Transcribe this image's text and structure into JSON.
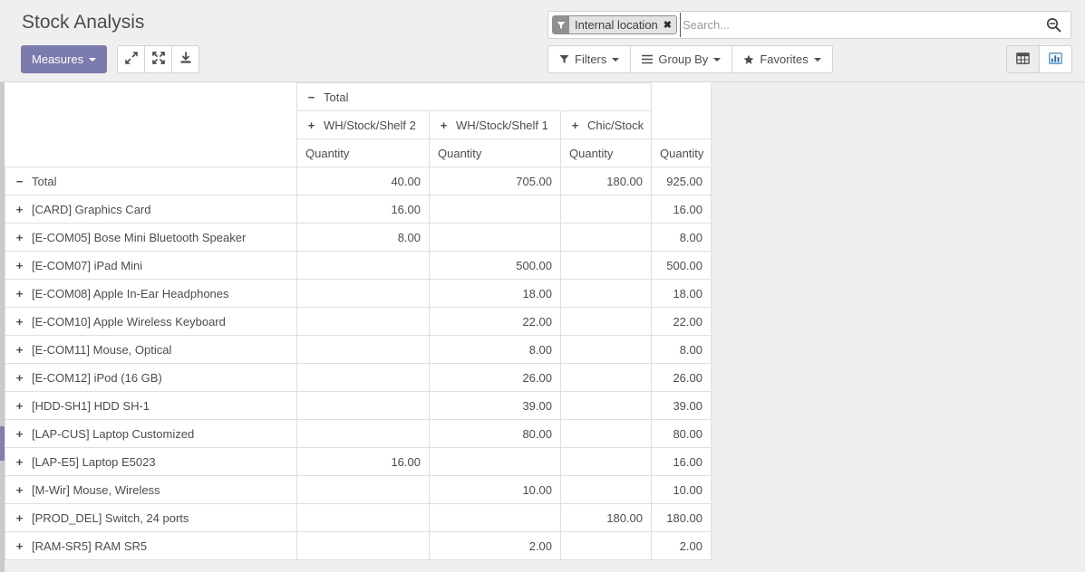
{
  "header": {
    "title": "Stock Analysis"
  },
  "toolbar": {
    "measures_label": "Measures",
    "expand_icon": "expand-arrows-icon",
    "flip_icon": "flip-axis-icon",
    "download_icon": "download-icon"
  },
  "search": {
    "placeholder": "Search...",
    "value": "",
    "search_icon": "search-icon",
    "facets": [
      {
        "icon": "filter-funnel-icon",
        "label": "Internal location",
        "close": "✖"
      }
    ]
  },
  "search_buttons": [
    {
      "name": "filters-button",
      "icon": "filter-funnel-icon",
      "label": "Filters"
    },
    {
      "name": "group-by-button",
      "icon": "list-lines-icon",
      "label": "Group By"
    },
    {
      "name": "favorites-button",
      "icon": "star-icon",
      "label": "Favorites"
    }
  ],
  "view_switcher": [
    {
      "name": "pivot-view-button",
      "icon": "table-grid-icon",
      "active": true
    },
    {
      "name": "graph-view-button",
      "icon": "bar-chart-icon",
      "active": false
    }
  ],
  "pivot": {
    "col_group_root": {
      "toggle": "−",
      "label": "Total"
    },
    "col_headers": [
      {
        "toggle": "+",
        "label": "WH/Stock/Shelf 2"
      },
      {
        "toggle": "+",
        "label": "WH/Stock/Shelf 1"
      },
      {
        "toggle": "+",
        "label": "Chic/Stock"
      }
    ],
    "measure_label": "Quantity",
    "total_row": {
      "toggle": "−",
      "label": "Total",
      "values": [
        "40.00",
        "705.00",
        "180.00"
      ],
      "total": "925.00"
    },
    "rows": [
      {
        "toggle": "+",
        "label": "[CARD] Graphics Card",
        "values": [
          "16.00",
          "",
          ""
        ],
        "total": "16.00"
      },
      {
        "toggle": "+",
        "label": "[E-COM05] Bose Mini Bluetooth Speaker",
        "values": [
          "8.00",
          "",
          ""
        ],
        "total": "8.00"
      },
      {
        "toggle": "+",
        "label": "[E-COM07] iPad Mini",
        "values": [
          "",
          "500.00",
          ""
        ],
        "total": "500.00"
      },
      {
        "toggle": "+",
        "label": "[E-COM08] Apple In-Ear Headphones",
        "values": [
          "",
          "18.00",
          ""
        ],
        "total": "18.00"
      },
      {
        "toggle": "+",
        "label": "[E-COM10] Apple Wireless Keyboard",
        "values": [
          "",
          "22.00",
          ""
        ],
        "total": "22.00"
      },
      {
        "toggle": "+",
        "label": "[E-COM11] Mouse, Optical",
        "values": [
          "",
          "8.00",
          ""
        ],
        "total": "8.00"
      },
      {
        "toggle": "+",
        "label": "[E-COM12] iPod (16 GB)",
        "values": [
          "",
          "26.00",
          ""
        ],
        "total": "26.00"
      },
      {
        "toggle": "+",
        "label": "[HDD-SH1] HDD SH-1",
        "values": [
          "",
          "39.00",
          ""
        ],
        "total": "39.00"
      },
      {
        "toggle": "+",
        "label": "[LAP-CUS] Laptop Customized",
        "values": [
          "",
          "80.00",
          ""
        ],
        "total": "80.00"
      },
      {
        "toggle": "+",
        "label": "[LAP-E5] Laptop E5023",
        "values": [
          "16.00",
          "",
          ""
        ],
        "total": "16.00"
      },
      {
        "toggle": "+",
        "label": "[M-Wir] Mouse, Wireless",
        "values": [
          "",
          "10.00",
          ""
        ],
        "total": "10.00"
      },
      {
        "toggle": "+",
        "label": "[PROD_DEL] Switch, 24 ports",
        "values": [
          "",
          "",
          "180.00"
        ],
        "total": "180.00"
      },
      {
        "toggle": "+",
        "label": "[RAM-SR5] RAM SR5",
        "values": [
          "",
          "2.00",
          ""
        ],
        "total": "2.00"
      }
    ]
  },
  "colors": {
    "accent": "#7c7bad",
    "graph_icon": "#4a90c4",
    "background": "#efefef",
    "border": "#dfdfdf"
  }
}
